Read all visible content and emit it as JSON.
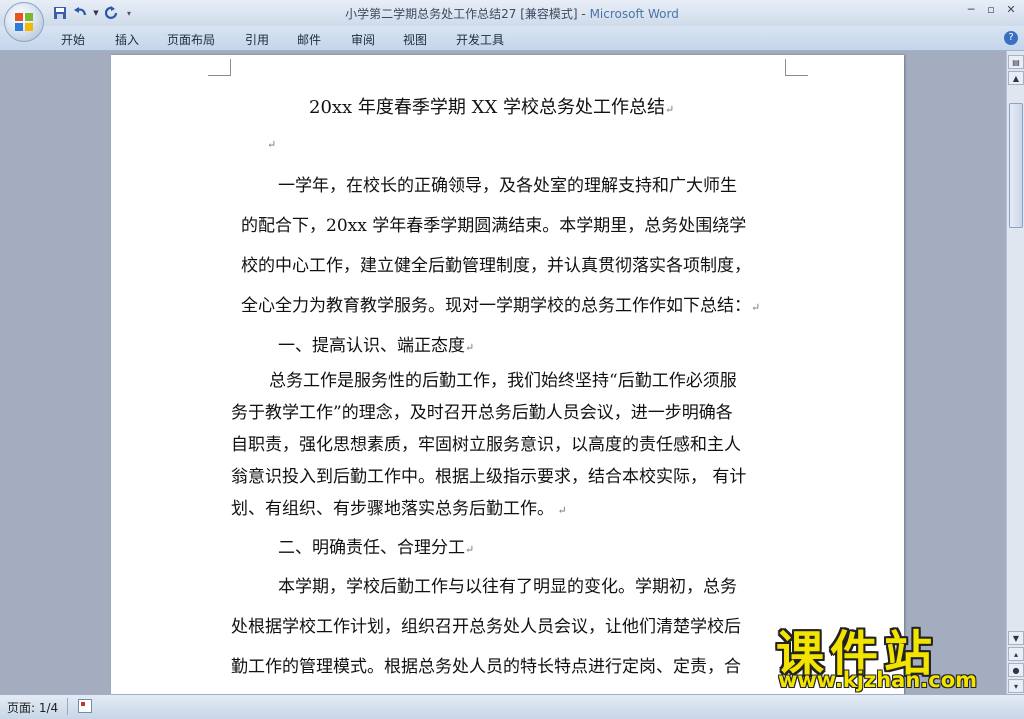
{
  "window": {
    "title_doc": "小学第二学期总务处工作总结27 [兼容模式] - ",
    "title_app": "Microsoft Word"
  },
  "ribbon": {
    "tabs": [
      "开始",
      "插入",
      "页面布局",
      "引用",
      "邮件",
      "审阅",
      "视图",
      "开发工具"
    ]
  },
  "document": {
    "title": "20xx 年度春季学期 XX 学校总务处工作总结",
    "lines": [
      "一学年，在校长的正确领导，及各处室的理解支持和广大师生",
      "的配合下，20xx 学年春季学期圆满结束。本学期里，总务处围绕学",
      "校的中心工作，建立健全后勤管理制度，并认真贯彻落实各项制度，",
      "全心全力为教育教学服务。现对一学期学校的总务工作作如下总结：",
      "一、提高认识、端正态度",
      "总务工作是服务性的后勤工作，我们始终坚持“后勤工作必须服",
      "务于教学工作”的理念，及时召开总务后勤人员会议，进一步明确各",
      "自职责，强化思想素质，牢固树立服务意识，以高度的责任感和主人",
      "翁意识投入到后勤工作中。根据上级指示要求，结合本校实际， 有计",
      "划、有组织、有步骤地落实总务后勤工作。",
      "二、明确责任、合理分工",
      "本学期，学校后勤工作与以往有了明显的变化。学期初，总务",
      "处根据学校工作计划，组织召开总务处人员会议，让他们清楚学校后",
      "勤工作的管理模式。根据总务处人员的特长特点进行定岗、定责，合"
    ]
  },
  "status": {
    "page": "页面: 1/4"
  },
  "watermark": {
    "big": "课件站",
    "url": "www.kjzhan.com"
  },
  "colors": {
    "ribbon": "#c5d5ea",
    "workspace": "#a3adbf",
    "watermark": "#f3e400"
  }
}
